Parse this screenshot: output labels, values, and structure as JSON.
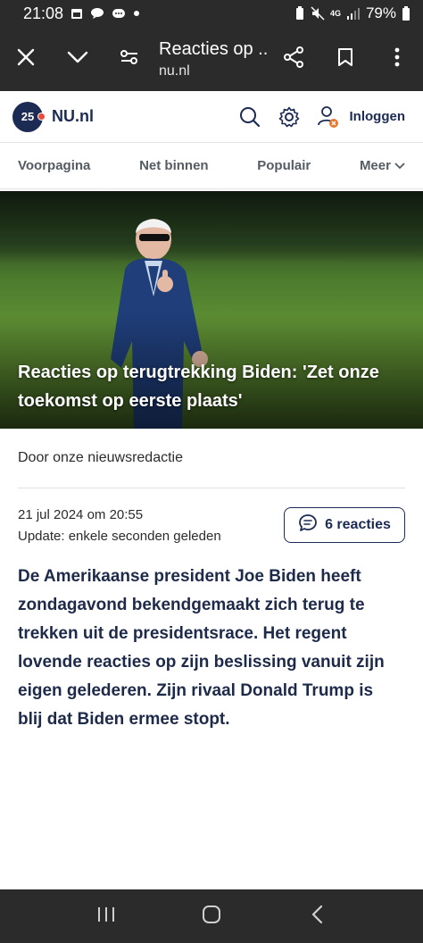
{
  "status_bar": {
    "time": "21:08",
    "battery": "79%",
    "network": "4G"
  },
  "browser": {
    "title": "Reacties op ...",
    "url": "nu.nl"
  },
  "site": {
    "logo_badge": "25",
    "logo_text": "NU.nl",
    "login_label": "Inloggen"
  },
  "nav": {
    "items": [
      "Voorpagina",
      "Net binnen",
      "Populair",
      "Meer"
    ]
  },
  "article": {
    "title": "Reacties op terugtrekking Biden: 'Zet onze toekomst op eerste plaats'",
    "author": "Door onze nieuwsredactie",
    "date": "21 jul 2024 om 20:55",
    "update": "Update: enkele seconden geleden",
    "reactions": "6 reacties",
    "lead": "De Amerikaanse president Joe Biden heeft zondagavond bekendgemaakt zich terug te trekken uit de presidentsrace. Het regent lovende reacties op zijn beslissing vanuit zijn eigen gelederen. Zijn rivaal Donald Trump is blij dat Biden ermee stopt."
  },
  "colors": {
    "brand_navy": "#1c2b54",
    "system_bar": "#2b2b2b",
    "accent_red": "#e84b3c",
    "login_badge_orange": "#e8772e"
  },
  "icons": {
    "close": "close-icon",
    "collapse": "chevron-down-icon",
    "page_settings": "tune-icon",
    "share": "share-icon",
    "bookmark": "bookmark-icon",
    "menu": "more-vertical-icon",
    "search": "search-icon",
    "settings": "gear-icon",
    "user": "user-icon",
    "comments": "comment-icon"
  }
}
